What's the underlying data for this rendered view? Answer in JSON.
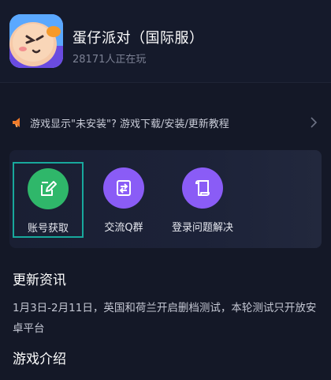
{
  "app": {
    "title": "蛋仔派对（国际服）",
    "players": "28171人正在玩"
  },
  "notice": {
    "text": "游戏显示\"未安装\"? 游戏下载/安装/更新教程",
    "icon": "megaphone-icon"
  },
  "features": [
    {
      "label": "账号获取",
      "icon": "edit-icon",
      "color": "#2fb76a",
      "selected": true
    },
    {
      "label": "交流Q群",
      "icon": "share-box-icon",
      "color": "#8a5cf6",
      "selected": false
    },
    {
      "label": "登录问题解决",
      "icon": "scroll-icon",
      "color": "#8a5cf6",
      "selected": false
    }
  ],
  "news": {
    "heading": "更新资讯",
    "body": "1月3日-2月11日，英国和荷兰开启删档测试，本轮测试只开放安卓平台"
  },
  "intro": {
    "heading": "游戏介绍"
  },
  "colors": {
    "background": "#141827",
    "selection_border": "#18a89c",
    "accent_green": "#2fb76a",
    "accent_purple": "#8a5cf6"
  }
}
